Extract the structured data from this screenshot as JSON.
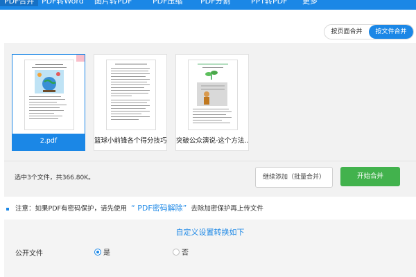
{
  "nav": {
    "items": [
      {
        "label": "PDF合并",
        "active": true
      },
      {
        "label": "PDF转Word",
        "active": false
      },
      {
        "label": "图片转PDF",
        "active": false
      },
      {
        "label": "PDF压缩",
        "active": false
      },
      {
        "label": "PDF分割",
        "active": false
      },
      {
        "label": "PPT转PDF",
        "active": false
      },
      {
        "label": "更多",
        "active": false
      }
    ]
  },
  "mode": {
    "by_page": "按页面合并",
    "by_file": "按文件合并",
    "selected": "by_file"
  },
  "files": [
    {
      "name": "2.pdf",
      "selected": true
    },
    {
      "name": "篮球小前锋各个得分技巧...",
      "selected": false
    },
    {
      "name": "突破公众演说-这个方法...",
      "selected": false
    }
  ],
  "status": {
    "text": "选中3个文件，共366.80K。"
  },
  "buttons": {
    "add_more": "继续添加（批量合并）",
    "start": "开始合并"
  },
  "notice": {
    "prefix": "注意：如果PDF有密码保护，请先使用",
    "link": "“ PDF密码解除”",
    "suffix": "去除加密保护再上传文件"
  },
  "settings": {
    "title": "自定义设置转换如下",
    "public_label": "公开文件",
    "yes": "是",
    "no": "否",
    "public_value": "是"
  },
  "colors": {
    "primary": "#1b87e6",
    "start_button": "#42b24d"
  }
}
